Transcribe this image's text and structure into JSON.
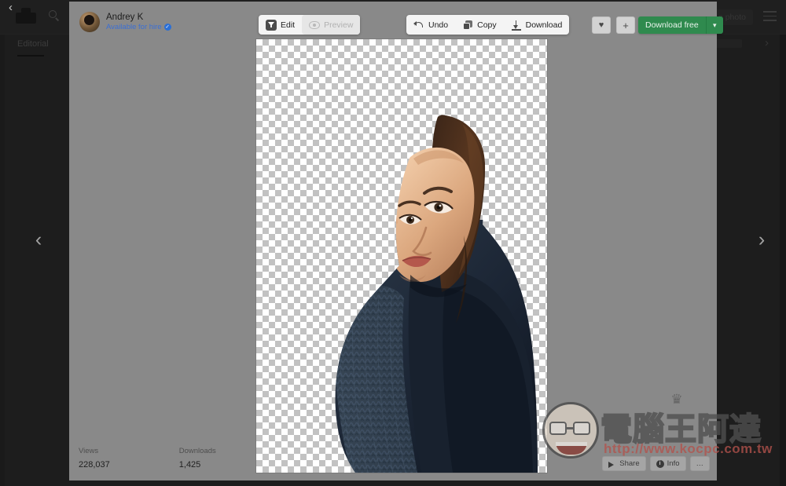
{
  "background": {
    "logo_icon": "unsplash-camera-logo",
    "close_icon": "close-x-icon",
    "search_icon": "search-icon",
    "editorial_tab": "Editorial",
    "submit_photo_button": "a photo",
    "menu_icon": "hamburger-menu-icon",
    "next_icon": "chevron-right-icon"
  },
  "lightbox": {
    "prev_icon": "chevron-left-icon",
    "next_icon": "chevron-right-icon",
    "prev_glyph": "‹",
    "next_glyph": "›"
  },
  "author": {
    "name": "Andrey K",
    "hire_text": "Available for hire",
    "verified_glyph": "✓",
    "avatar_icon": "user-avatar"
  },
  "editor": {
    "mode_toolbar": [
      {
        "label": "Edit",
        "icon": "filter-icon",
        "state": "active"
      },
      {
        "label": "Preview",
        "icon": "eye-icon",
        "state": "disabled"
      }
    ],
    "tools_toolbar": [
      {
        "label": "Undo",
        "icon": "undo-icon"
      },
      {
        "label": "Copy",
        "icon": "copy-icon"
      },
      {
        "label": "Download",
        "icon": "download-icon"
      }
    ]
  },
  "actions": {
    "like_label": "♥",
    "like_icon": "heart-icon",
    "add_label": "+",
    "add_icon": "plus-icon",
    "download_free_label": "Download free",
    "download_free_chevron": "▾",
    "download_free_color": "#2f8a4e"
  },
  "stats": [
    {
      "label": "Views",
      "value": "228,037"
    },
    {
      "label": "Downloads",
      "value": "1,425"
    }
  ],
  "bottom_actions": [
    {
      "label": "Share",
      "icon": "share-icon"
    },
    {
      "label": "Info",
      "icon": "info-icon"
    },
    {
      "label": "…",
      "icon": "more-ellipsis-icon"
    }
  ],
  "canvas": {
    "transparency_icon": "checkerboard-transparency",
    "photo_alt": "portrait-woman-navy-sweater-background-removed"
  },
  "watermark": {
    "title": "電腦王阿達",
    "url": "http://www.kocpc.com.tw",
    "crown_glyph": "♛",
    "mascot_icon": "mascot-face-icon"
  }
}
